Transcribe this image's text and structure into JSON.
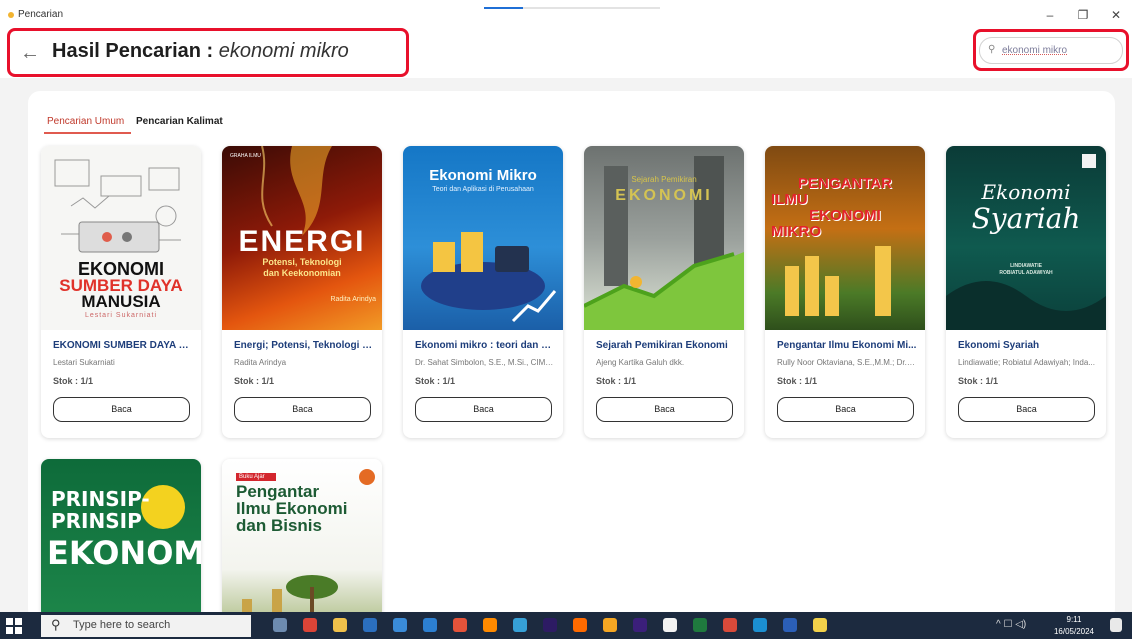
{
  "window": {
    "app_title": "Pencarian",
    "progress_fraction": 0.22,
    "controls": {
      "minimize": "–",
      "restore": "❐",
      "close": "✕"
    }
  },
  "header": {
    "back_icon": "←",
    "title_label": "Hasil Pencarian :",
    "query": "ekonomi mikro"
  },
  "search": {
    "icon": "⚲",
    "value": "ekonomi mikro"
  },
  "tabs": [
    {
      "label": "Pencarian Umum",
      "active": true
    },
    {
      "label": "Pencarian Kalimat",
      "active": false
    }
  ],
  "read_label": "Baca",
  "books": [
    {
      "title": "EKONOMI SUMBER DAYA M...",
      "author": "Lestari Sukarniati",
      "stock": "Stok : 1/1",
      "cover": {
        "l1": "EKONOMI",
        "l2": "SUMBER DAYA",
        "l3": "MANUSIA",
        "l4": "Lestari Sukarniati"
      }
    },
    {
      "title": "Energi; Potensi, Teknologi d...",
      "author": "Radita Arindya",
      "stock": "Stok : 1/1",
      "cover": {
        "l0": "GRAHA ILMU",
        "l1": "ENERGI",
        "l2": "Potensi, Teknologi",
        "l3": "dan Keekonomian",
        "l4": "Radita Arindya"
      }
    },
    {
      "title": "Ekonomi mikro : teori dan a...",
      "author": "Dr. Sahat Simbolon, S.E., M.Si., CIMBA.",
      "stock": "Stok : 1/1",
      "cover": {
        "l1": "Ekonomi Mikro",
        "l2": "Teori dan Aplikasi di Perusahaan"
      }
    },
    {
      "title": "Sejarah Pemikiran Ekonomi",
      "author": "Ajeng Kartika Galuh dkk.",
      "stock": "Stok : 1/1",
      "cover": {
        "l1": "Sejarah Pemikiran",
        "l2": "EKONOMI"
      }
    },
    {
      "title": "Pengantar Ilmu Ekonomi Mi...",
      "author": "Rully Noor Oktaviana, S.E.,M.M.; Dr. I...",
      "stock": "Stok : 1/1",
      "cover": {
        "l1": "PENGANTAR",
        "l2": "ILMU",
        "l3": "EKONOMI",
        "l4": "MIKRO"
      }
    },
    {
      "title": "Ekonomi Syariah",
      "author": "Lindiawatie; Robiatul Adawiyah; Inda...",
      "stock": "Stok : 1/1",
      "cover": {
        "l1": "Ekonomi",
        "l2": "Syariah",
        "l3": "LINDIAWATIE",
        "l4": "ROBIATUL ADAWIYAH"
      }
    },
    {
      "title": "",
      "author": "",
      "stock": "",
      "cover": {
        "l1": "PRINSIP-",
        "l2": "PRINSIP",
        "l3": "EKONOMI"
      }
    },
    {
      "title": "",
      "author": "",
      "stock": "",
      "cover": {
        "l0": "Buku Ajar",
        "l1": "Pengantar",
        "l2": "Ilmu Ekonomi",
        "l3": "dan Bisnis"
      }
    }
  ],
  "taskbar": {
    "search_placeholder": "Type here to search",
    "time": "9:11",
    "date": "16/05/2024",
    "tray_icons": "^ ☐ ◁)",
    "app_icons": [
      "task-view",
      "chrome",
      "file-explorer",
      "photoshop",
      "calculator",
      "photos",
      "chrome-alt",
      "app",
      "chrome-2",
      "after-effects",
      "illustrator",
      "chrome-3",
      "premiere",
      "media-player",
      "excel",
      "chrome-4",
      "edge",
      "word",
      "app-yellow"
    ],
    "colors": {
      "bar": "#1c2a3f",
      "accent": "#e8102b"
    }
  }
}
